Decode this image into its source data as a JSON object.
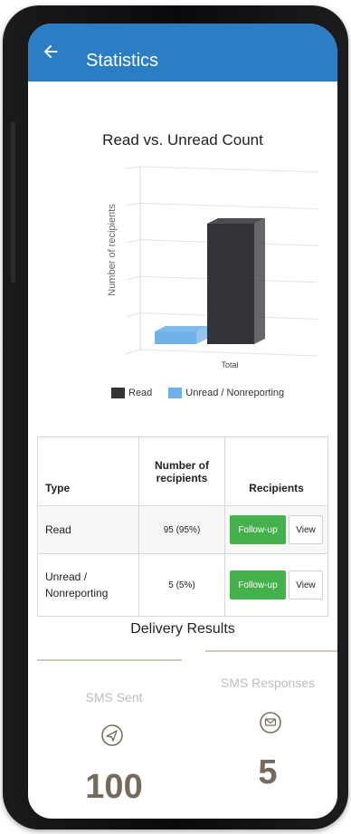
{
  "appbar": {
    "title": "Statistics",
    "color": "#2b7dc4"
  },
  "chart_data": {
    "type": "bar",
    "title": "Read vs. Unread Count",
    "xlabel": "",
    "ylabel": "Number of recipients",
    "categories": [
      "Total"
    ],
    "series": [
      {
        "name": "Read",
        "values": [
          95
        ],
        "color": "#33343a"
      },
      {
        "name": "Unread / Nonreporting",
        "values": [
          5
        ],
        "color": "#6fb1e8"
      }
    ],
    "ylim": [
      0,
      100
    ],
    "grid": true,
    "legend_position": "bottom"
  },
  "table": {
    "headers": {
      "type": "Type",
      "count": "Number of recipients",
      "recipients": "Recipients"
    },
    "rows": [
      {
        "type": "Read",
        "count": "95 (95%)",
        "follow_label": "Follow-up",
        "view_label": "View"
      },
      {
        "type": "Unread / Nonreporting",
        "count": "5 (5%)",
        "follow_label": "Follow-up",
        "view_label": "View"
      }
    ]
  },
  "delivery": {
    "title": "Delivery Results",
    "sms_sent_label": "SMS Sent",
    "sms_sent_value": "100",
    "sms_responses_label": "SMS Responses",
    "sms_responses_value": "5",
    "sent_icon": "send-icon",
    "responses_icon": "message-icon"
  }
}
